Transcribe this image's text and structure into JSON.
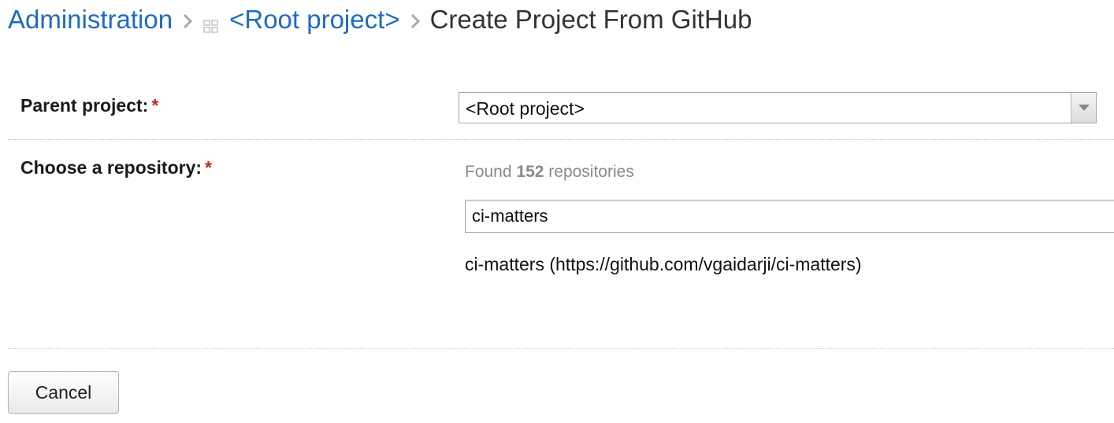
{
  "breadcrumb": {
    "items": [
      {
        "label": "Administration"
      },
      {
        "label": "<Root project>"
      }
    ],
    "current": "Create Project From GitHub"
  },
  "form": {
    "parent_project": {
      "label": "Parent project:",
      "required_mark": "*",
      "selected_value": "<Root project>"
    },
    "repository": {
      "label": "Choose a repository:",
      "required_mark": "*",
      "found_prefix": "Found",
      "found_count": "152",
      "found_suffix": "repositories",
      "search_value": "ci-matters",
      "results": [
        "ci-matters (https://github.com/vgaidarji/ci-matters)"
      ]
    }
  },
  "buttons": {
    "cancel_label": "Cancel"
  },
  "colors": {
    "link": "#1f6bbf",
    "required": "#d42020",
    "muted_text": "#8a8a8a"
  },
  "icons": {
    "breadcrumb_separator": "chevron-right-icon",
    "project": "project-grid-icon",
    "select_arrow": "caret-down-icon"
  }
}
